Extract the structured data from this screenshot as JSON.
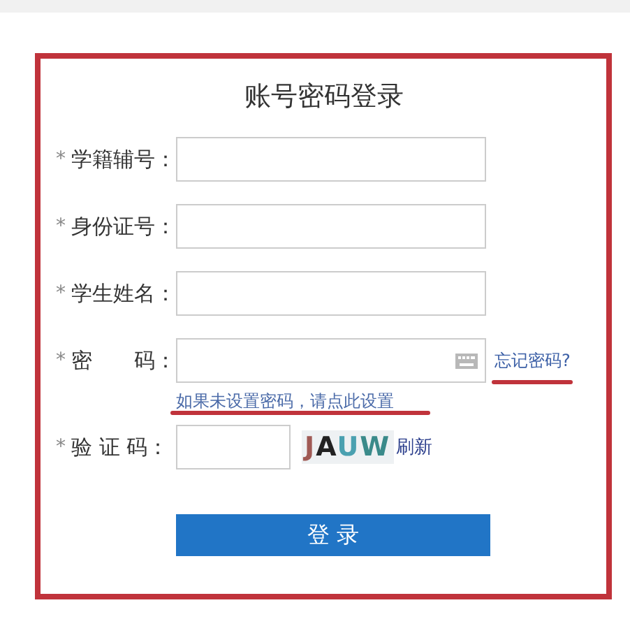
{
  "title": "账号密码登录",
  "fields": [
    {
      "kind": "text",
      "required": "*",
      "label": "学籍辅号："
    },
    {
      "kind": "text",
      "required": "*",
      "label": "身份证号："
    },
    {
      "kind": "text",
      "required": "*",
      "label": "学生姓名："
    },
    {
      "kind": "password",
      "required": "*",
      "label": "密　　码：",
      "link": "忘记密码?"
    }
  ],
  "hint": "如果未设置密码，请点此设置",
  "captcha": {
    "required": "*",
    "label": "验 证 码：",
    "code": "JAUW",
    "refresh": "刷新"
  },
  "submit": "登 录"
}
